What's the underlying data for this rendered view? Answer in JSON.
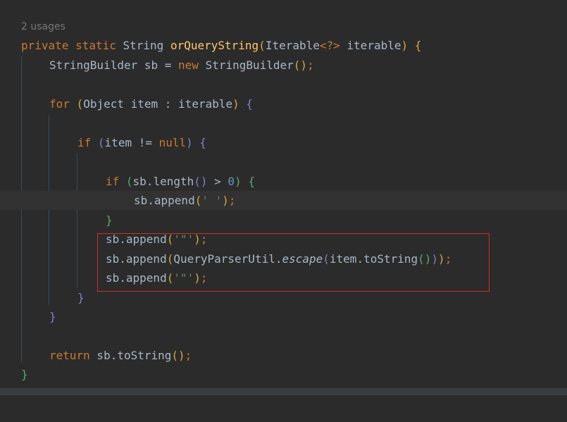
{
  "usages_hint": "2 usages",
  "code": {
    "l1": {
      "t1": "private",
      "t2": " ",
      "t3": "static",
      "t4": " String ",
      "t5": "orQueryString",
      "t6": "(",
      "t7": "Iterable",
      "t8": "<?>",
      "t9": " iterable",
      "t10": ")",
      "t11": " ",
      "t12": "{"
    },
    "l2": {
      "t1": "StringBuilder sb = ",
      "t2": "new",
      "t3": " StringBuilder",
      "t4": "()",
      "t5": ";"
    },
    "l3": {
      "t1": "for",
      "t2": " ",
      "t3": "(",
      "t4": "Object item : iterable",
      "t5": ")",
      "t6": " ",
      "t7": "{"
    },
    "l4": {
      "t1": "if",
      "t2": " ",
      "t3": "(",
      "t4": "item != ",
      "t5": "null",
      "t6": ")",
      "t7": " ",
      "t8": "{"
    },
    "l5": {
      "t1": "if",
      "t2": " ",
      "t3": "(",
      "t4": "sb.length",
      "t5": "()",
      "t6": " > ",
      "t7": "0",
      "t8": ")",
      "t9": " ",
      "t10": "{"
    },
    "l6": {
      "t1": "sb.append",
      "t2": "(",
      "t3": "' '",
      "t4": ")",
      "t5": ";"
    },
    "l7": {
      "t1": "}"
    },
    "l8": {
      "t1": "sb.append",
      "t2": "(",
      "t3": "'\"'",
      "t4": ")",
      "t5": ";"
    },
    "l9": {
      "t1": "sb.append",
      "t2": "(",
      "t3": "QueryParserUtil.",
      "t4": "escape",
      "t5": "(",
      "t6": "item.toString",
      "t7": "()",
      "t8": ")",
      "t9": ")",
      "t10": ";"
    },
    "l10": {
      "t1": "sb.append",
      "t2": "(",
      "t3": "'\"'",
      "t4": ")",
      "t5": ";"
    },
    "l11": {
      "t1": "}"
    },
    "l12": {
      "t1": "}"
    },
    "l13": {
      "t1": "return",
      "t2": " sb.toString",
      "t3": "()",
      "t4": ";"
    },
    "l14": {
      "t1": "}"
    }
  }
}
